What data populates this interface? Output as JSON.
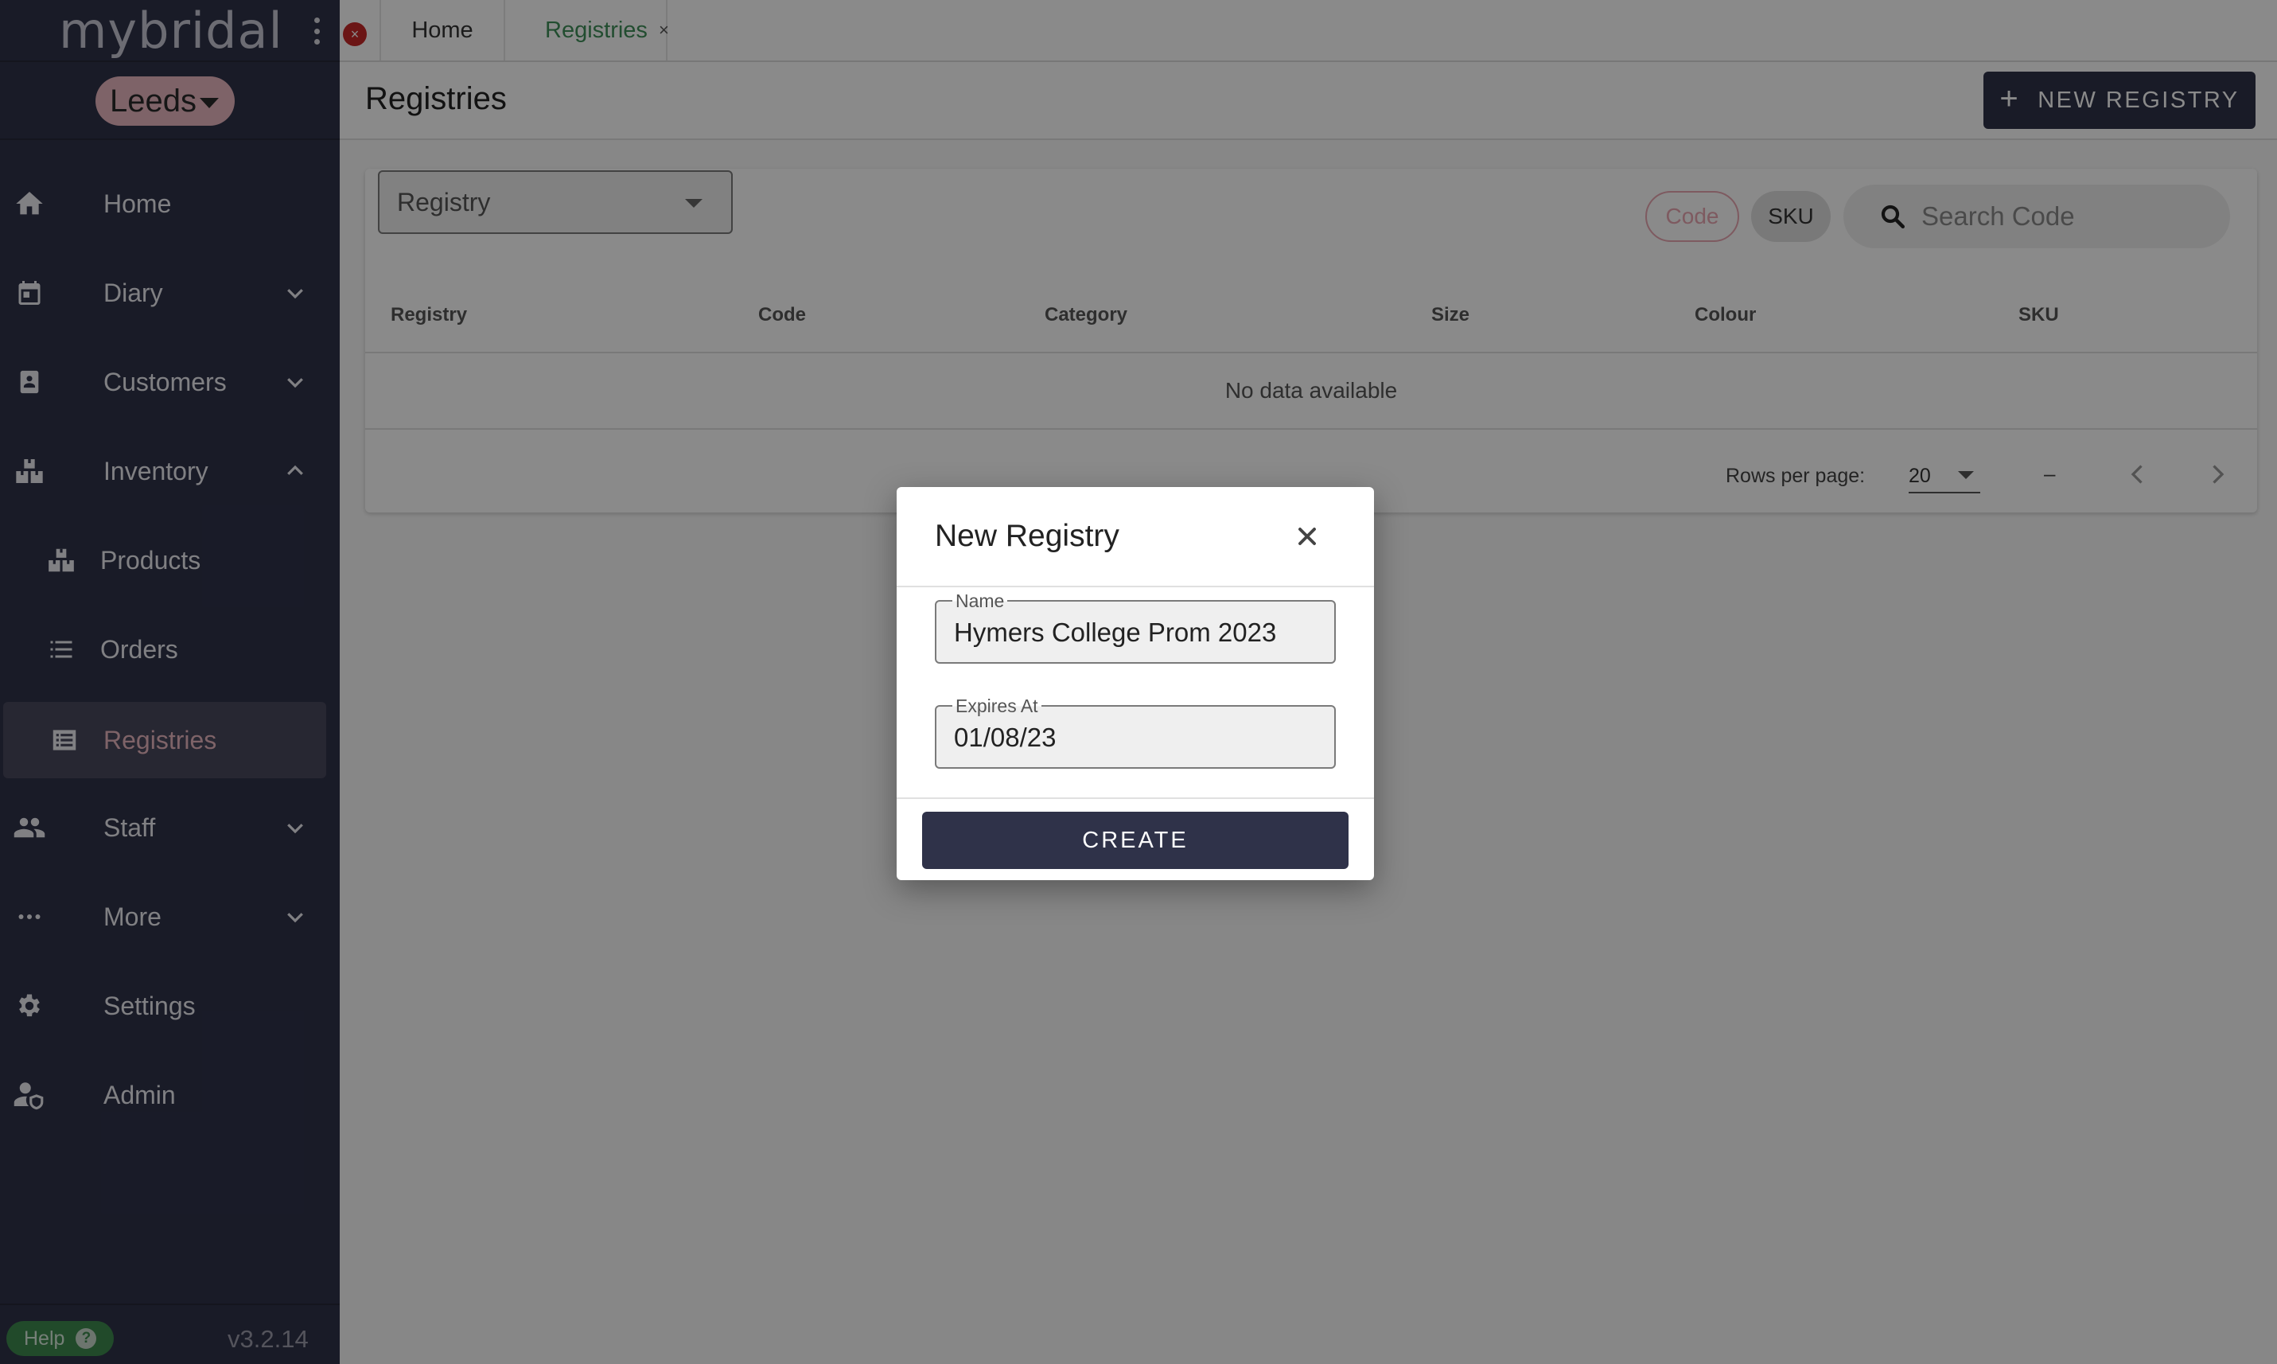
{
  "sidebar": {
    "logo": "mybridal",
    "location": "Leeds",
    "items": [
      {
        "label": "Home",
        "icon": "home-icon",
        "chevron": ""
      },
      {
        "label": "Diary",
        "icon": "calendar-icon",
        "chevron": "down"
      },
      {
        "label": "Customers",
        "icon": "contact-card-icon",
        "chevron": "down"
      },
      {
        "label": "Inventory",
        "icon": "boxes-icon",
        "chevron": "up"
      },
      {
        "label": "Products",
        "icon": "boxes-icon",
        "sub": true
      },
      {
        "label": "Orders",
        "icon": "list-icon",
        "sub": true
      },
      {
        "label": "Registries",
        "icon": "registry-icon",
        "sub": true,
        "active": true
      },
      {
        "label": "Staff",
        "icon": "people-icon",
        "chevron": "down"
      },
      {
        "label": "More",
        "icon": "more-dots-icon",
        "chevron": "down"
      },
      {
        "label": "Settings",
        "icon": "gear-icon",
        "chevron": ""
      },
      {
        "label": "Admin",
        "icon": "admin-user-icon",
        "chevron": ""
      }
    ],
    "help_label": "Help",
    "version": "v3.2.14"
  },
  "tabs": {
    "close_all_glyph": "×",
    "home": "Home",
    "registries": "Registries",
    "registries_close": "×"
  },
  "page": {
    "title": "Registries",
    "new_button": "NEW REGISTRY",
    "new_button_plus": "+"
  },
  "filters": {
    "registry_select": "Registry",
    "chip_code": "Code",
    "chip_sku": "SKU",
    "search_placeholder": "Search Code"
  },
  "table": {
    "columns": [
      "Registry",
      "Code",
      "Category",
      "Size",
      "Colour",
      "SKU"
    ],
    "empty_text": "No data available",
    "rows_per_page_label": "Rows per page:",
    "rows_per_page_value": "20",
    "range_text": "–"
  },
  "dialog": {
    "title": "New Registry",
    "name_label": "Name",
    "name_value": "Hymers College Prom 2023",
    "expires_label": "Expires At",
    "expires_value": "01/08/23",
    "create_label": "CREATE"
  },
  "colors": {
    "sidebar_bg": "#2f3249",
    "accent_pink": "#e9b7c0",
    "tab_active_green": "#3f8f5a",
    "help_green": "#3e8a4f",
    "close_red": "#c62828"
  }
}
